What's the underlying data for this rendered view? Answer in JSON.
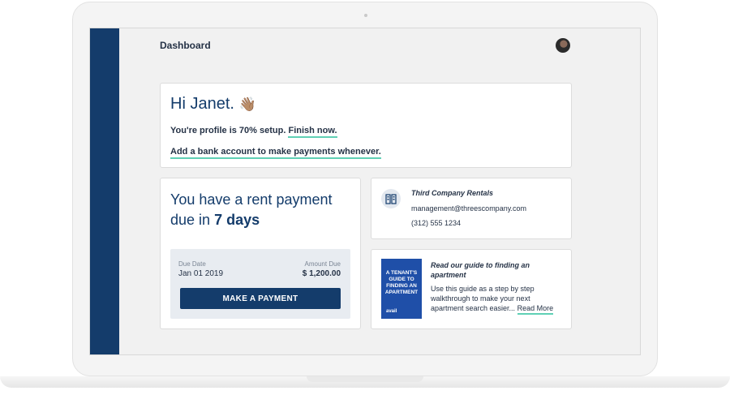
{
  "header": {
    "title": "Dashboard"
  },
  "welcome": {
    "greeting": "Hi Janet.",
    "wave_emoji": "👋🏽",
    "profile_text": "You're profile is 70% setup.",
    "profile_percent": 70,
    "finish_link": "Finish now.",
    "bank_link": "Add a bank account to make payments whenever."
  },
  "rent": {
    "heading_prefix": "You have a rent payment due in",
    "heading_days": "7 days",
    "due_date_label": "Due Date",
    "due_date": "Jan 01 2019",
    "amount_label": "Amount Due",
    "amount": "$ 1,200.00",
    "pay_button": "MAKE A PAYMENT"
  },
  "company": {
    "icon": "building-icon",
    "name": "Third Company Rentals",
    "email": "management@threescompany.com",
    "phone": "(312) 555 1234"
  },
  "guide": {
    "cover_text": "A TENANT'S GUIDE TO FINDING AN APARTMENT",
    "cover_brand": "avail",
    "title": "Read our guide to finding an apartment",
    "body": "Use this guide as a step by step walkthrough to make your next apartment search easier...",
    "read_more": "Read More"
  },
  "colors": {
    "brand_navy": "#143c6b",
    "accent_teal": "#5fd0b5"
  }
}
